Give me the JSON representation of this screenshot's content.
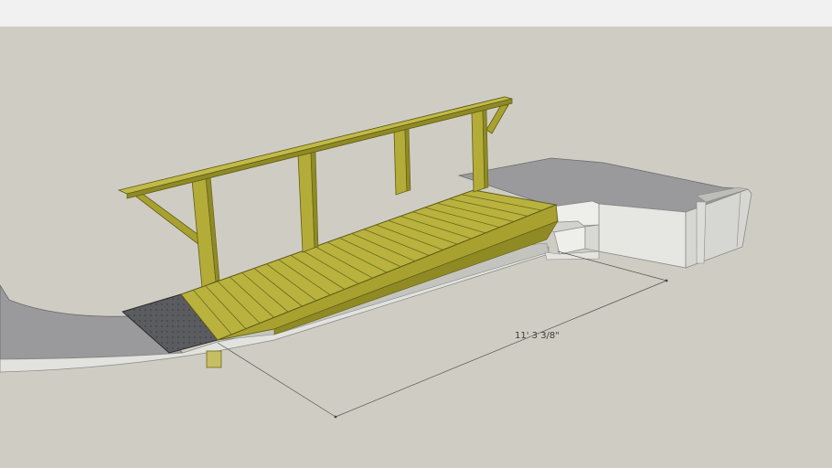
{
  "viewport": {
    "sky_color": "#f1f1f2",
    "ground_color": "#cfcdc3"
  },
  "model": {
    "components": [
      "handrail",
      "ramp-deck",
      "entry-mat",
      "concrete-path",
      "concrete-landing",
      "landing-steps",
      "ramp-stringer",
      "support-post"
    ],
    "colors": {
      "wood_light": "#b9b23e",
      "wood_mid": "#a8a12f",
      "wood_dark": "#8f8a24",
      "wood_shadow": "#6d6a1c",
      "concrete_top": "#9a9a9c",
      "concrete_side": "#dadad7",
      "concrete_face": "#ebebe8",
      "mat": "#5b5c60"
    }
  },
  "dimension": {
    "label": "11' 3 3/8\""
  }
}
